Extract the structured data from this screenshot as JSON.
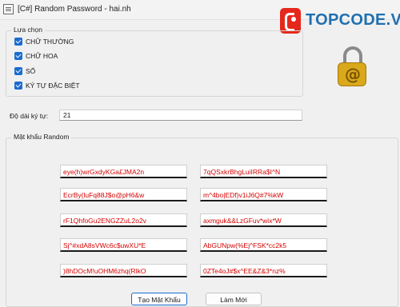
{
  "window": {
    "title": "[C#] Random Password - hai.nh"
  },
  "logo": {
    "text": "TOPCODE.VN"
  },
  "options": {
    "legend": "Lựa chọn",
    "items": [
      {
        "label": "CHỮ THƯỜNG",
        "checked": true
      },
      {
        "label": "CHỮ HOA",
        "checked": true
      },
      {
        "label": "SỐ",
        "checked": true
      },
      {
        "label": "KÝ TỰ ĐẶC BIỆT",
        "checked": true
      }
    ]
  },
  "length": {
    "label": "Độ dài ký tự:",
    "value": "21"
  },
  "results": {
    "legend": "Mật khẩu Random",
    "passwords": [
      "eye(h)wrGxdyKGa£JMA2n",
      "7qQSxkrBhgLuiIRRa$I^N",
      "EcrBy(luFq88J$o@pH6&w",
      "m^4bo|EDf)v1iJ6Q#7%kW",
      "rF1QhfoGu2ENGZZuL2o2v",
      "axmguk&&LzGFuv*wix*W",
      "Sj^#xdA8sVWc6c$uwXU*E",
      "AbGUNpw(%Ej^FSK*cc2k5",
      ")8hDOcM!uOHM6zhq(RlkO",
      "0ZTe4oJ#$x^EE&Z&3*nz%"
    ]
  },
  "buttons": {
    "generate": "Tạo Mật Khẩu",
    "reset": "Làm Mới"
  },
  "colors": {
    "password_text": "#d40000",
    "accent": "#1a6ccf",
    "logo_blue": "#1f6fb0",
    "logo_red": "#e5281c"
  }
}
